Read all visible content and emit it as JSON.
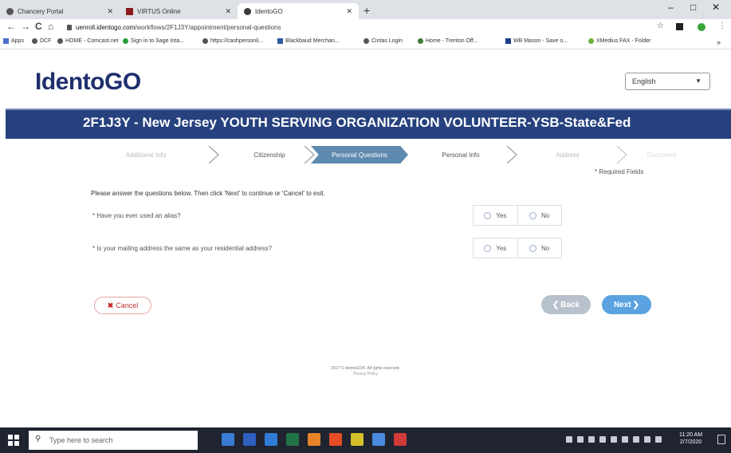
{
  "browser": {
    "tabs": [
      {
        "title": "Chancery Portal",
        "icon_color": "#555555"
      },
      {
        "title": "VIRTUS Online",
        "icon_color": "#8a1c1c"
      },
      {
        "title": "IdentoGO",
        "icon_color": "#3b3b3b"
      }
    ],
    "new_tab_label": "+",
    "window_controls": {
      "minimize": "–",
      "maximize": "□",
      "close": "✕"
    },
    "nav": {
      "back": "←",
      "forward": "→",
      "reload": "C",
      "home": "⌂"
    },
    "url_host": "uenroll.identogo.com",
    "url_path": "/workflows/2F1J3Y/appointment/personal-questions",
    "bookmarks": [
      "Apps",
      "DCF",
      "HOME - Comcast.net",
      "Sign in to Sage Inta...",
      "https://cashpersonli...",
      "Blackbaud Merchan...",
      "Cintas Login",
      "Home - Trenton Off...",
      "WB Mason - Save o...",
      "XMedius FAX - Folder"
    ],
    "bookmarks_more": "»"
  },
  "page": {
    "logo": "IdentoGO",
    "language": "English",
    "banner_title": "2F1J3Y - New Jersey YOUTH SERVING ORGANIZATION VOLUNTEER-YSB-State&Fed",
    "steps": [
      "Additional Info",
      "Citizenship",
      "Personal Questions",
      "Personal Info",
      "Address",
      "Document"
    ],
    "active_step": "Personal Questions",
    "required_note": "* Required Fields",
    "instructions": "Please answer the questions below. Then click 'Next' to continue or 'Cancel' to exit.",
    "questions": [
      {
        "text": "* Have you ever used an alias?",
        "yes": "Yes",
        "no": "No"
      },
      {
        "text": "* Is your mailing address the same as your residential address?",
        "yes": "Yes",
        "no": "No"
      }
    ],
    "cancel_label": "Cancel",
    "cancel_icon": "✖",
    "back_label": "Back",
    "next_label": "Next",
    "footer_copyright": "2017 © IdentoGO®. All rights reserved.",
    "footer_privacy": "Privacy Policy"
  },
  "taskbar": {
    "search_placeholder": "Type here to search",
    "time": "11:20 AM",
    "date": "2/7/2020",
    "apps": [
      "#3a7bd5",
      "#2f5fbf",
      "#2f7bd8",
      "#217346",
      "#e6842a",
      "#e44d26",
      "#d4c02a",
      "#4a8be0",
      "#d23a3a"
    ]
  }
}
